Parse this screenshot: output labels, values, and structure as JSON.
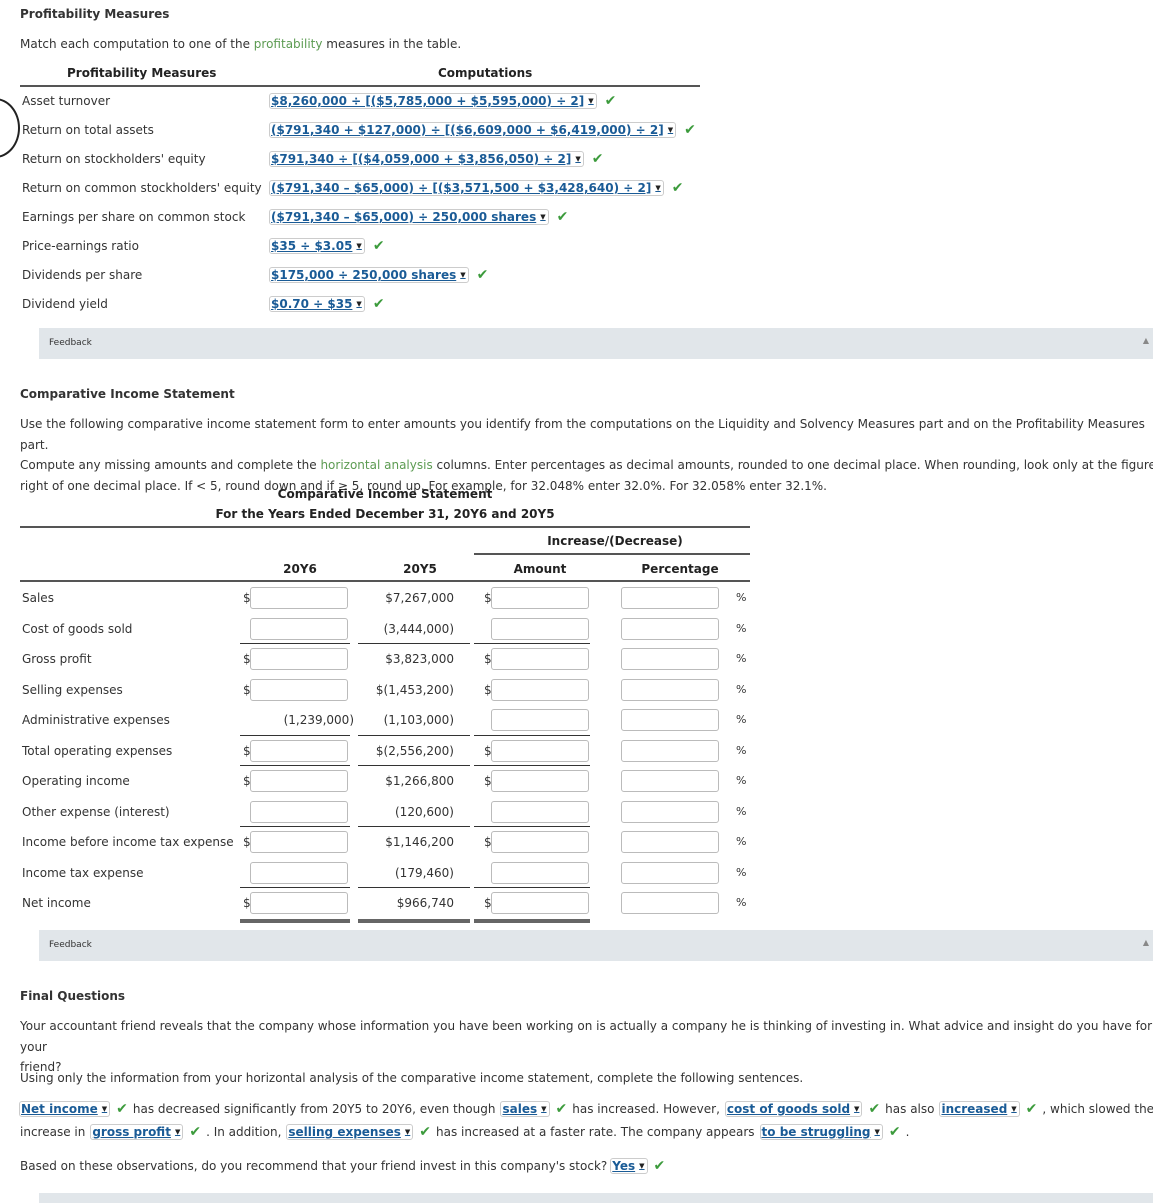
{
  "profitability": {
    "title": "Profitability Measures",
    "instruction_pre": "Match each computation to one of the ",
    "instruction_link": "profitability",
    "instruction_post": " measures in the table.",
    "col_measures": "Profitability Measures",
    "col_computations": "Computations",
    "rows": [
      {
        "measure": "Asset turnover",
        "computation": "$8,260,000 ÷ [($5,785,000 + $5,595,000) ÷ 2]",
        "correct": true
      },
      {
        "measure": "Return on total assets",
        "computation": "($791,340 + $127,000) ÷ [($6,609,000 + $6,419,000) ÷ 2]",
        "correct": true
      },
      {
        "measure": "Return on stockholders' equity",
        "computation": "$791,340 ÷ [($4,059,000 + $3,856,050) ÷ 2]",
        "correct": true
      },
      {
        "measure": "Return on common stockholders' equity",
        "computation": "($791,340 – $65,000) ÷ [($3,571,500 + $3,428,640) ÷ 2]",
        "correct": true
      },
      {
        "measure": "Earnings per share on common stock",
        "computation": "($791,340 – $65,000) ÷ 250,000 shares",
        "correct": true
      },
      {
        "measure": "Price-earnings ratio",
        "computation": "$35 ÷ $3.05",
        "correct": true
      },
      {
        "measure": "Dividends per share",
        "computation": "$175,000 ÷ 250,000 shares",
        "correct": true
      },
      {
        "measure": "Dividend yield",
        "computation": "$0.70 ÷ $35",
        "correct": true
      }
    ],
    "feedback_label": "Feedback"
  },
  "income_statement": {
    "section_title": "Comparative Income Statement",
    "instructions": [
      "Use the following comparative income statement form to enter amounts you identify from the computations on the Liquidity and Solvency Measures part and on the Profitability Measures part.",
      "Compute any missing amounts and complete the ",
      "horizontal analysis",
      " columns. Enter percentages as decimal amounts, rounded to one decimal place. When rounding, look only at the figure to the",
      "right of one decimal place. If < 5, round down and if ≥ 5, round up. For example, for 32.048% enter 32.0%. For 32.058% enter 32.1%."
    ],
    "table_title": "Comparative Income Statement",
    "table_subtitle": "For the Years Ended December 31, 20Y6 and 20Y5",
    "group_header": "Increase/(Decrease)",
    "columns": [
      "20Y6",
      "20Y5",
      "Amount",
      "Percentage"
    ],
    "currency_symbol": "$",
    "percent_symbol": "%",
    "rows": [
      {
        "label": "Sales",
        "y6": "",
        "y5": "$7,267,000",
        "amount": "",
        "percentage": "",
        "dollar_y6": true,
        "dollar_amt": true
      },
      {
        "label": "Cost of goods sold",
        "y6": "",
        "y5": "(3,444,000)",
        "amount": "",
        "percentage": "",
        "dollar_y6": false,
        "dollar_amt": false
      },
      {
        "label": "Gross profit",
        "y6": "",
        "y5": "$3,823,000",
        "amount": "",
        "percentage": "",
        "dollar_y6": true,
        "dollar_amt": true
      },
      {
        "label": "Selling expenses",
        "y6": "",
        "y5": "$(1,453,200)",
        "amount": "",
        "percentage": "",
        "dollar_y6": true,
        "dollar_amt": true
      },
      {
        "label": "Administrative expenses",
        "y6_fixed": "(1,239,000)",
        "y5": "(1,103,000)",
        "amount": "",
        "percentage": "",
        "dollar_y6": false,
        "dollar_amt": false
      },
      {
        "label": "Total operating expenses",
        "y6": "",
        "y5": "$(2,556,200)",
        "amount": "",
        "percentage": "",
        "dollar_y6": true,
        "dollar_amt": true
      },
      {
        "label": "Operating income",
        "y6": "",
        "y5": "$1,266,800",
        "amount": "",
        "percentage": "",
        "dollar_y6": true,
        "dollar_amt": true
      },
      {
        "label": "Other expense (interest)",
        "y6": "",
        "y5": "(120,600)",
        "amount": "",
        "percentage": "",
        "dollar_y6": false,
        "dollar_amt": false
      },
      {
        "label": "Income before income tax expense",
        "y6": "",
        "y5": "$1,146,200",
        "amount": "",
        "percentage": "",
        "dollar_y6": true,
        "dollar_amt": true
      },
      {
        "label": "Income tax expense",
        "y6": "",
        "y5": "(179,460)",
        "amount": "",
        "percentage": "",
        "dollar_y6": false,
        "dollar_amt": false
      },
      {
        "label": "Net income",
        "y6": "",
        "y5": "$966,740",
        "amount": "",
        "percentage": "",
        "dollar_y6": true,
        "dollar_amt": true
      }
    ],
    "feedback_label": "Feedback"
  },
  "final_questions": {
    "title": "Final Questions",
    "intro_line1": "Your accountant friend reveals that the company whose information you have been working on is actually a company he is thinking of investing in. What advice and insight do you have for your",
    "intro_line2": "friend?",
    "instruction": "Using only the information from your horizontal analysis of the comparative income statement, complete the following sentences.",
    "s1_dd1": "Net income",
    "s1_t1": "has decreased significantly from 20Y5 to 20Y6, even though",
    "s1_dd2": "sales",
    "s1_t2": "has increased. However,",
    "s1_dd3": "cost of goods sold",
    "s1_t3": "has also",
    "s1_dd4": "increased",
    "s1_t4": ", which slowed the",
    "s2_t0": "increase in",
    "s2_dd1": "gross profit",
    "s2_t1": ". In addition,",
    "s2_dd2": "selling expenses",
    "s2_t2": "has increased at a faster rate. The company appears",
    "s2_dd3": "to be struggling",
    "s2_t3": ".",
    "s3_t0": "Based on these observations, do you recommend that your friend invest in this company's stock?",
    "s3_dd1": "Yes"
  },
  "icons": {
    "check": "✔",
    "caret": "▼",
    "collapse": "▲"
  },
  "colors": {
    "link": "#1a5b96",
    "check": "#3c9b3c",
    "glossary": "#5c9b52",
    "feedback_bg": "#e1e6ea"
  }
}
